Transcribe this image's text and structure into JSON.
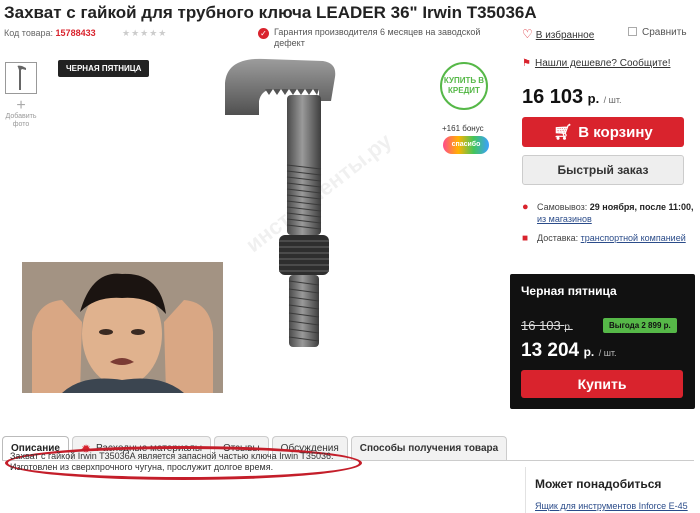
{
  "product": {
    "title": "Захват с гайкой для трубного ключа LEADER 36\" Irwin T35036A",
    "code_label": "Код товара:",
    "code_value": "15788433",
    "guarantee": "Гарантия производителя 6 месяцев на заводской дефект",
    "favorites": "В избранное",
    "compare": "Сравнить",
    "add_photo": "Добавить фото",
    "black_friday_badge": "ЧЕРНАЯ ПЯТНИЦА",
    "credit_badge": "КУПИТЬ В КРЕДИТ",
    "bonus": "+161 бонус",
    "spasibo": "спасибо"
  },
  "buy": {
    "cheaper": "Нашли дешевле? Сообщите!",
    "price": "16 103",
    "currency": "р.",
    "unit": "/ шт.",
    "cart_button": "В корзину",
    "quick_order": "Быстрый заказ",
    "pickup_label": "Самовывоз:",
    "pickup_date": "29 ноября, после 11:00,",
    "pickup_link": "из магазинов",
    "delivery_label": "Доставка:",
    "delivery_link": "транспортной компанией"
  },
  "black_friday": {
    "title": "Черная пятница",
    "old_price": "16 103",
    "old_currency": "р.",
    "saving": "Выгода 2 899 р.",
    "new_price": "13 204",
    "currency": "р.",
    "unit": "/ шт.",
    "buy_button": "Купить"
  },
  "tabs": [
    {
      "label": "Описание"
    },
    {
      "label": "Расходные материалы"
    },
    {
      "label": "Отзывы"
    },
    {
      "label": "Обсуждения"
    },
    {
      "label": "Способы получения товара"
    }
  ],
  "description": {
    "line1": "Захват с гайкой Irwin T35036A является запасной частью ключа Irwin T35036.",
    "line2": "Изготовлен из сверхпрочного чугуна, прослужит долгое время."
  },
  "related": {
    "title": "Может понадобиться",
    "link": "Ящик для инструментов Inforce E-45"
  },
  "colors": {
    "accent": "#d9232d",
    "green": "#56b848",
    "dark": "#111111"
  }
}
